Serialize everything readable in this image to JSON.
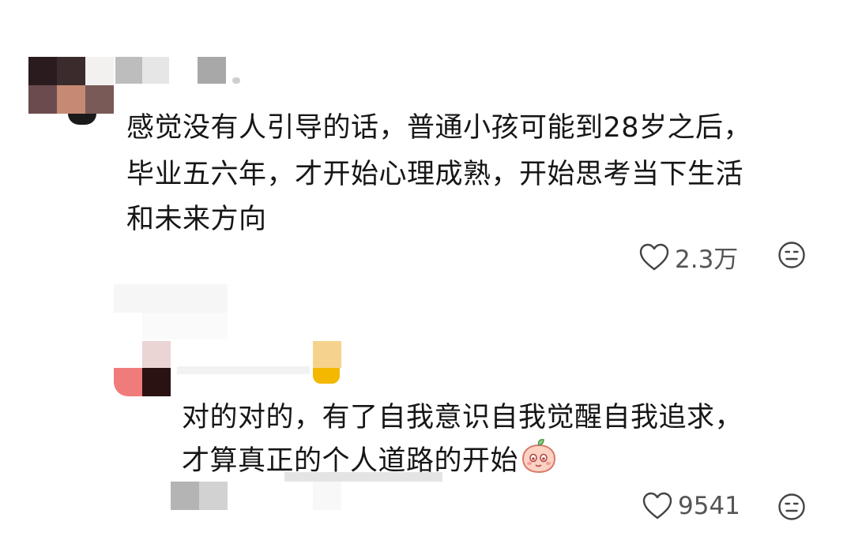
{
  "comments": [
    {
      "text_lines": [
        "感觉没有人引导的话，普通小孩可能到28岁之后，",
        "毕业五六年，才开始心理成熟，开始思考当下生活",
        "和未来方向"
      ],
      "likes": "2.3万",
      "like_icon": "heart-outline-icon",
      "dislike_icon": "neutral-face-icon"
    },
    {
      "text_lines": [
        "对的对的，有了自我意识自我觉醒自我追求，",
        "才算真正的个人道路的开始"
      ],
      "emoji": "peach-emoji-icon",
      "likes": "9541",
      "like_icon": "heart-outline-icon",
      "dislike_icon": "neutral-face-icon"
    }
  ],
  "colors": {
    "text": "#161616",
    "count": "#555555",
    "icon": "#444444"
  }
}
